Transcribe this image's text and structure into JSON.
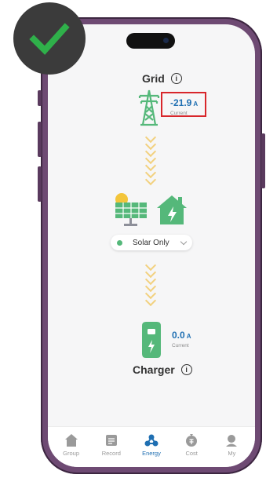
{
  "grid": {
    "title": "Grid",
    "value": "-21.9",
    "unit": "A",
    "caption": "Current"
  },
  "mode": {
    "selected": "Solar Only"
  },
  "charger": {
    "title": "Charger",
    "value": "0.0",
    "unit": "A",
    "caption": "Current"
  },
  "nav": {
    "items": [
      {
        "label": "Group",
        "icon": "house-icon",
        "active": false
      },
      {
        "label": "Record",
        "icon": "record-icon",
        "active": false
      },
      {
        "label": "Energy",
        "icon": "energy-icon",
        "active": true
      },
      {
        "label": "Cost",
        "icon": "cost-icon",
        "active": false
      },
      {
        "label": "My",
        "icon": "profile-icon",
        "active": false
      }
    ]
  },
  "colors": {
    "accent": "#1f6fb2",
    "green": "#55b87a",
    "flow": "#f2c862",
    "highlight_box": "#d8262b",
    "frame": "#6e4a73"
  }
}
